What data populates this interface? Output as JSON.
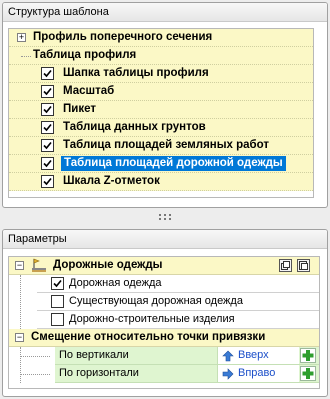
{
  "structure_panel": {
    "title": "Структура шаблона",
    "items": [
      {
        "label": "Профиль поперечного сечения",
        "checked": null
      },
      {
        "label": "Таблица профиля",
        "checked": null
      },
      {
        "label": "Шапка таблицы профиля",
        "checked": true
      },
      {
        "label": "Масштаб",
        "checked": true
      },
      {
        "label": "Пикет",
        "checked": true
      },
      {
        "label": "Таблица данных грунтов",
        "checked": true
      },
      {
        "label": "Таблица площадей земляных работ",
        "checked": true
      },
      {
        "label": "Таблица площадей дорожной одежды",
        "checked": true,
        "selected": true
      },
      {
        "label": "Шкала Z-отметок",
        "checked": true
      }
    ]
  },
  "params_panel": {
    "title": "Параметры",
    "group1": {
      "label": "Дорожные одежды",
      "items": [
        {
          "label": "Дорожная одежда",
          "checked": true
        },
        {
          "label": "Существующая дорожная одежда",
          "checked": false
        },
        {
          "label": "Дорожно-строительные изделия",
          "checked": false
        }
      ]
    },
    "group2": {
      "label": "Смещение относительно точки привязки",
      "rows": [
        {
          "label": "По вертикали",
          "value": "Вверх",
          "arrow": "up-arrow-icon"
        },
        {
          "label": "По горизонтали",
          "value": "Вправо",
          "arrow": "right-arrow-icon"
        }
      ]
    }
  },
  "colors": {
    "row_highlight": "#fbf8c6",
    "selection": "#0078d7",
    "param_row": "#dff5d0",
    "value_text": "#1c4fc9",
    "plus_green": "#2e9e2e"
  }
}
